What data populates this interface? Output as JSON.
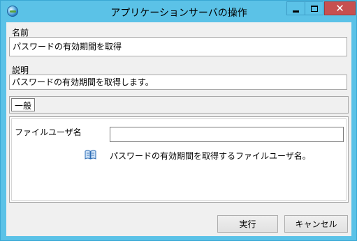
{
  "window": {
    "title": "アプリケーションサーバの操作",
    "icon": "globe-icon",
    "colors": {
      "frame": "#5bc2e7",
      "close": "#c75050"
    }
  },
  "fields": {
    "name_label": "名前",
    "name_value": "パスワードの有効期間を取得",
    "description_label": "説明",
    "description_value": "パスワードの有効期間を取得します。"
  },
  "tabs": [
    "一般"
  ],
  "general": {
    "file_user_label": "ファイルユーザ名",
    "file_user_value": "",
    "help_icon": "book-icon",
    "file_user_help": "パスワードの有効期間を取得するファイルユーザ名。"
  },
  "buttons": {
    "execute": "実行",
    "cancel": "キャンセル"
  }
}
